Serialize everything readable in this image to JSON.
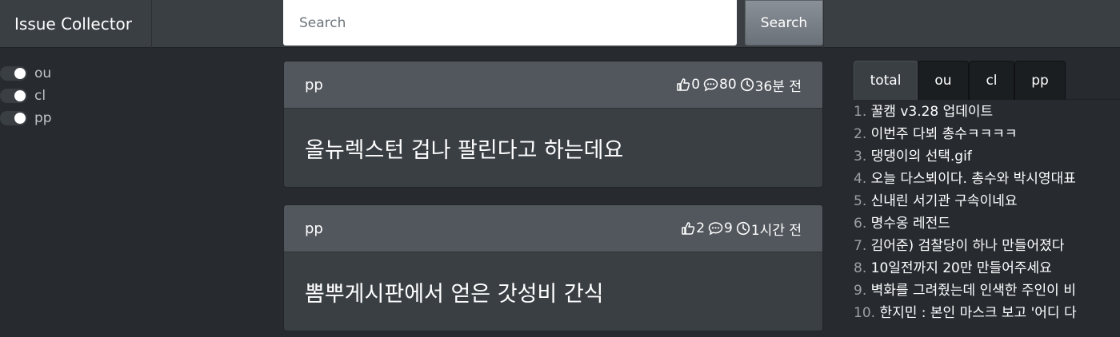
{
  "navbar": {
    "brand": "Issue Collector",
    "search_placeholder": "Search",
    "search_button": "Search"
  },
  "filters": [
    {
      "label": "ou",
      "enabled": true
    },
    {
      "label": "cl",
      "enabled": true
    },
    {
      "label": "pp",
      "enabled": true
    }
  ],
  "posts": [
    {
      "source": "pp",
      "likes": "0",
      "comments": "80",
      "time": "36분 전",
      "title": "올뉴렉스턴 겁나 팔린다고 하는데요"
    },
    {
      "source": "pp",
      "likes": "2",
      "comments": "9",
      "time": "1시간 전",
      "title": "뽐뿌게시판에서 얻은 갓성비 간식"
    }
  ],
  "ranking": {
    "tabs": [
      "total",
      "ou",
      "cl",
      "pp"
    ],
    "active_tab": "total",
    "items": [
      {
        "num": "1.",
        "title": "꿀캠 v3.28 업데이트"
      },
      {
        "num": "2.",
        "title": "이번주 다뵈 총수ㅋㅋㅋㅋ"
      },
      {
        "num": "3.",
        "title": "댕댕이의 선택.gif"
      },
      {
        "num": "4.",
        "title": "오늘 다스뵈이다. 총수와 박시영대표"
      },
      {
        "num": "5.",
        "title": "신내린 서기관 구속이네요"
      },
      {
        "num": "6.",
        "title": "명수옹 레전드"
      },
      {
        "num": "7.",
        "title": "김어준) 검찰당이 하나 만들어졌다"
      },
      {
        "num": "8.",
        "title": "10일전까지 20만 만들어주세요"
      },
      {
        "num": "9.",
        "title": "벽화를 그려줬는데 인색한 주인이 비"
      },
      {
        "num": "10.",
        "title": "한지민 : 본인 마스크 보고 '어디 다"
      }
    ]
  },
  "icons": {
    "likes": "thumbs-up-icon",
    "comments": "comment-dots-icon",
    "time": "clock-icon"
  }
}
